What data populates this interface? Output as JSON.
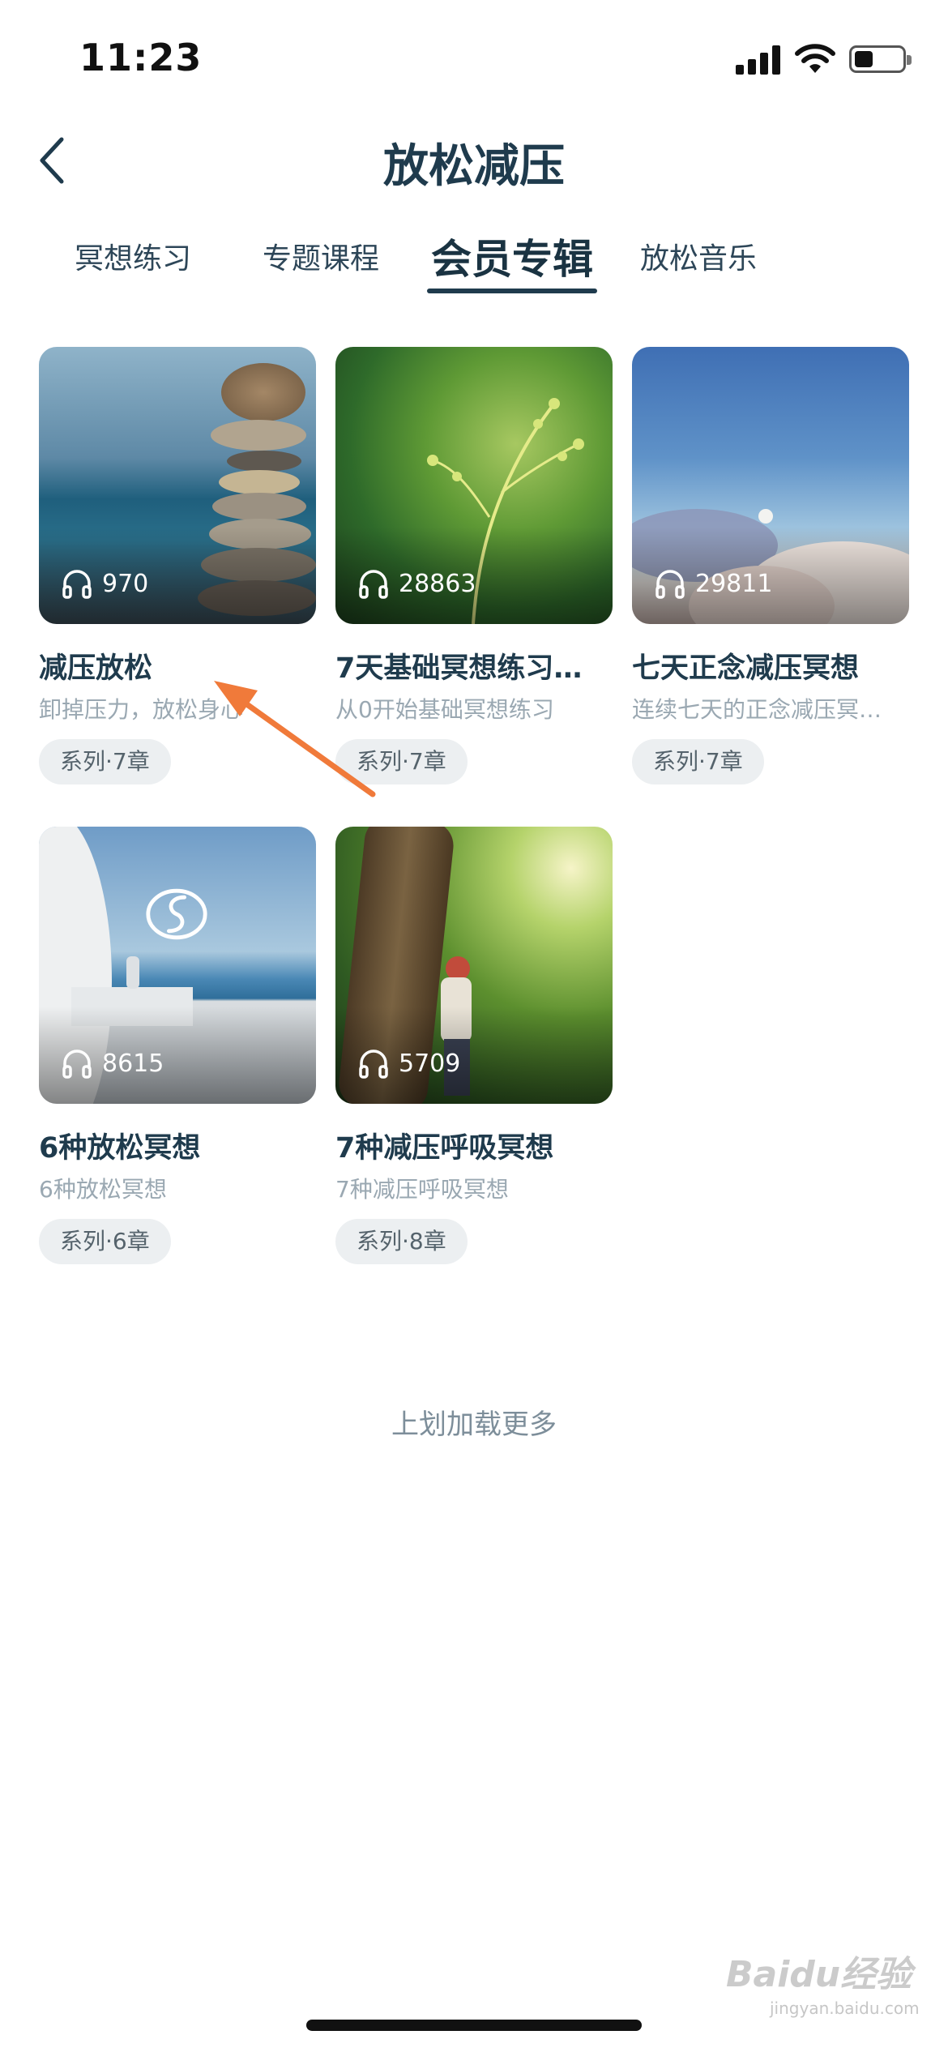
{
  "status_bar": {
    "time": "11:23"
  },
  "nav": {
    "title": "放松减压"
  },
  "tabs": [
    {
      "label": "冥想练习",
      "active": false
    },
    {
      "label": "专题课程",
      "active": false
    },
    {
      "label": "会员专辑",
      "active": true
    },
    {
      "label": "放松音乐",
      "active": false
    }
  ],
  "cards": [
    {
      "title": "减压放松",
      "subtitle": "卸掉压力，放松身心",
      "plays": "970",
      "badge": "系列·7章"
    },
    {
      "title": "7天基础冥想练习…",
      "subtitle": "从0开始基础冥想练习",
      "plays": "28863",
      "badge": "系列·7章"
    },
    {
      "title": "七天正念减压冥想",
      "subtitle": "连续七天的正念减压冥…",
      "plays": "29811",
      "badge": "系列·7章"
    },
    {
      "title": "6种放松冥想",
      "subtitle": "6种放松冥想",
      "plays": "8615",
      "badge": "系列·6章"
    },
    {
      "title": "7种减压呼吸冥想",
      "subtitle": "7种减压呼吸冥想",
      "plays": "5709",
      "badge": "系列·8章"
    }
  ],
  "load_more": "上划加载更多",
  "watermark": {
    "brand": "Baidu经验",
    "url": "jingyan.baidu.com"
  },
  "colors": {
    "primary_text": "#1f3b4d",
    "annotation_arrow": "#f07a3a"
  },
  "icons": [
    "back-chevron-icon",
    "signal-icon",
    "wifi-icon",
    "battery-icon",
    "headphones-icon"
  ]
}
